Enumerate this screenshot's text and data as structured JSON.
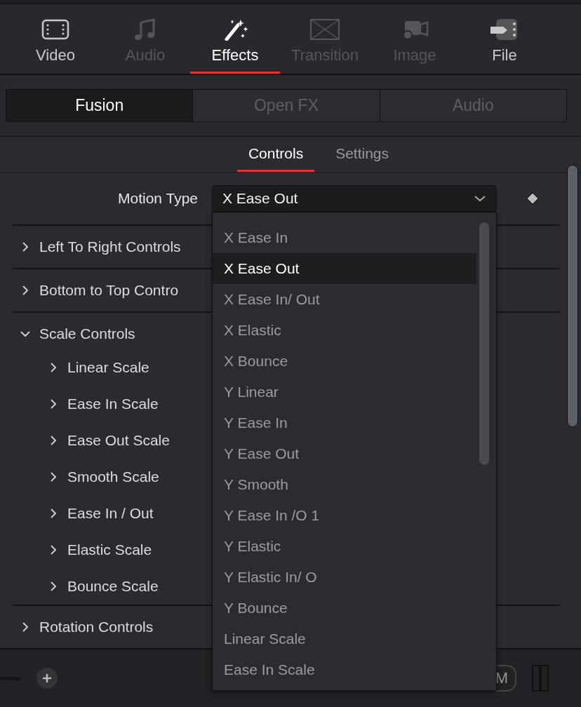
{
  "tabs": [
    {
      "label": "Video",
      "selected": false,
      "disabled": false
    },
    {
      "label": "Audio",
      "selected": false,
      "disabled": true
    },
    {
      "label": "Effects",
      "selected": true,
      "disabled": false
    },
    {
      "label": "Transition",
      "selected": false,
      "disabled": true
    },
    {
      "label": "Image",
      "selected": false,
      "disabled": true
    },
    {
      "label": "File",
      "selected": false,
      "disabled": false
    }
  ],
  "segments": [
    {
      "label": "Fusion",
      "selected": true
    },
    {
      "label": "Open FX",
      "selected": false
    },
    {
      "label": "Audio",
      "selected": false
    }
  ],
  "panel_tabs": [
    {
      "label": "Controls",
      "selected": true
    },
    {
      "label": "Settings",
      "selected": false
    }
  ],
  "motion_type": {
    "label": "Motion Type",
    "value": "X Ease Out"
  },
  "tree": [
    {
      "label": "Left To Right Controls",
      "expanded": false
    },
    {
      "label": "Bottom to Top Contro",
      "expanded": false
    },
    {
      "label": "Scale Controls",
      "expanded": true,
      "children": [
        {
          "label": "Linear Scale",
          "expanded": false
        },
        {
          "label": "Ease In Scale",
          "expanded": false
        },
        {
          "label": "Ease Out Scale",
          "expanded": false
        },
        {
          "label": "Smooth Scale",
          "expanded": false
        },
        {
          "label": "Ease In / Out",
          "expanded": false
        },
        {
          "label": "Elastic Scale",
          "expanded": false
        },
        {
          "label": "Bounce Scale",
          "expanded": false
        }
      ]
    },
    {
      "label": "Rotation Controls",
      "expanded": false
    }
  ],
  "dropdown": {
    "items": [
      {
        "label": "X Ease In",
        "selected": false
      },
      {
        "label": "X Ease Out",
        "selected": true
      },
      {
        "label": "X Ease In/ Out",
        "selected": false
      },
      {
        "label": "X Elastic",
        "selected": false
      },
      {
        "label": "X Bounce",
        "selected": false
      },
      {
        "label": "Y Linear",
        "selected": false
      },
      {
        "label": "Y Ease In",
        "selected": false
      },
      {
        "label": "Y Ease Out",
        "selected": false
      },
      {
        "label": "Y Smooth",
        "selected": false
      },
      {
        "label": "Y Ease In /O 1",
        "selected": false
      },
      {
        "label": "Y Elastic",
        "selected": false
      },
      {
        "label": "Y Elastic In/ O",
        "selected": false
      },
      {
        "label": "Y Bounce",
        "selected": false
      },
      {
        "label": "Linear Scale",
        "selected": false
      },
      {
        "label": "Ease In Scale",
        "selected": false
      }
    ]
  },
  "bottom_bar": {
    "badge": "M"
  }
}
